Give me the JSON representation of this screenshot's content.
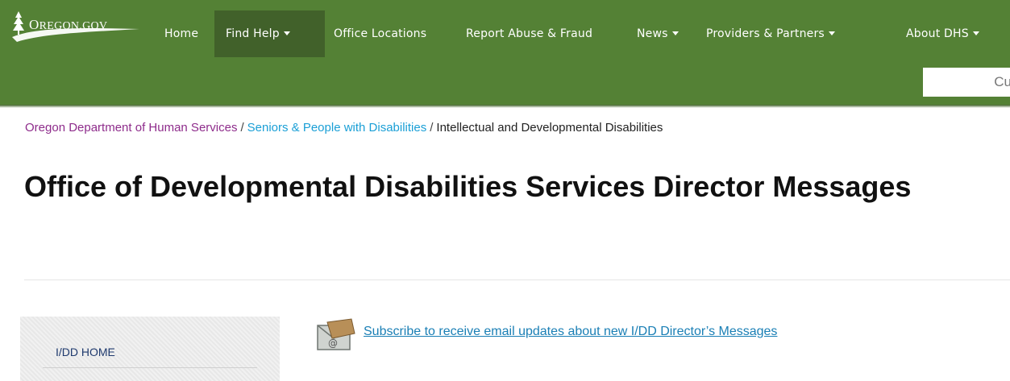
{
  "header": {
    "logo_prefix": "O",
    "logo_text": "REGON.GOV",
    "nav": [
      {
        "label": "Home"
      },
      {
        "label": "Find Help"
      },
      {
        "label": "Office Locations"
      },
      {
        "label": "Report Abuse & Fraud"
      },
      {
        "label": "News"
      },
      {
        "label": "Providers & Partners"
      },
      {
        "label": "About DHS"
      }
    ],
    "search_placeholder": "Cu",
    "colors": {
      "bar": "#548135",
      "active": "#41612a"
    }
  },
  "breadcrumb": {
    "items": [
      "Oregon Department of Human Services",
      "Seniors & People with Disabilities",
      "Intellectual and Developmental Disabilities"
    ],
    "separator": "/"
  },
  "page": {
    "title": "Office of Developmental Disabilities Services Director Messages"
  },
  "sidebar": {
    "home_label": "I/DD HOME"
  },
  "main": {
    "subscribe_text": "Subscribe to receive email updates about new I/DD Director’s Messages",
    "subscribe_icon": "email-envelope-icon"
  }
}
